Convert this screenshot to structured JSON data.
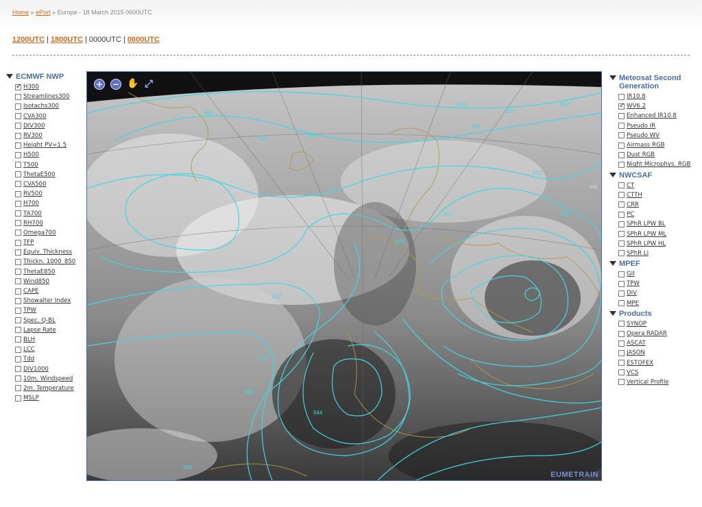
{
  "breadcrumb": {
    "home": "Home",
    "sep1": "»",
    "eport": "ePort",
    "rest": "» Europe - 18 March 2015 0600UTC"
  },
  "times": [
    {
      "label": "1200UTC",
      "link": true
    },
    {
      "label": "1800UTC",
      "link": true
    },
    {
      "label": "0000UTC",
      "link": false
    },
    {
      "label": "0600UTC",
      "link": true
    }
  ],
  "left_panel": {
    "title": "ECMWF NWP",
    "items": [
      {
        "label": "H300",
        "checked": true
      },
      {
        "label": "Streamlines300",
        "checked": false
      },
      {
        "label": "Isotachs300",
        "checked": false
      },
      {
        "label": "CVA300",
        "checked": false
      },
      {
        "label": "DIV300",
        "checked": false
      },
      {
        "label": "RV300",
        "checked": false
      },
      {
        "label": "Height PV=1.5",
        "checked": false
      },
      {
        "label": "H500",
        "checked": false
      },
      {
        "label": "T500",
        "checked": false
      },
      {
        "label": "ThetaE500",
        "checked": false
      },
      {
        "label": "CVA500",
        "checked": false
      },
      {
        "label": "RV500",
        "checked": false
      },
      {
        "label": "H700",
        "checked": false
      },
      {
        "label": "TA700",
        "checked": false
      },
      {
        "label": "RH700",
        "checked": false
      },
      {
        "label": "Omega700",
        "checked": false
      },
      {
        "label": "TFP",
        "checked": false
      },
      {
        "label": "Equiv. Thickness",
        "checked": false
      },
      {
        "label": "Thickn. 1000_850",
        "checked": false
      },
      {
        "label": "ThetaE850",
        "checked": false
      },
      {
        "label": "Wind850",
        "checked": false
      },
      {
        "label": "CAPE",
        "checked": false
      },
      {
        "label": "Showalter Index",
        "checked": false
      },
      {
        "label": "TPW",
        "checked": false
      },
      {
        "label": "Spec. Q-BL",
        "checked": false
      },
      {
        "label": "Lapse Rate",
        "checked": false
      },
      {
        "label": "BLH",
        "checked": false
      },
      {
        "label": "LCC",
        "checked": false
      },
      {
        "label": "Tdd",
        "checked": false
      },
      {
        "label": "DIV1000",
        "checked": false
      },
      {
        "label": "10m. Windspeed",
        "checked": false
      },
      {
        "label": "2m. Temperature",
        "checked": false
      },
      {
        "label": "MSLP",
        "checked": false
      }
    ]
  },
  "right_panel": {
    "groups": [
      {
        "title": "Meteosat Second Generation",
        "items": [
          {
            "label": "IR10.8",
            "checked": false
          },
          {
            "label": "WV6.2",
            "checked": true
          },
          {
            "label": "Enhanced IR10.8",
            "checked": false
          },
          {
            "label": "Pseudo IR",
            "checked": false
          },
          {
            "label": "Pseudo WV",
            "checked": false
          },
          {
            "label": "Airmass RGB",
            "checked": false
          },
          {
            "label": "Dust RGB",
            "checked": false
          },
          {
            "label": "Night Microphys. RGB",
            "checked": false
          }
        ]
      },
      {
        "title": "NWCSAF",
        "items": [
          {
            "label": "CT",
            "checked": false
          },
          {
            "label": "CTTH",
            "checked": false
          },
          {
            "label": "CRR",
            "checked": false
          },
          {
            "label": "PC",
            "checked": false
          },
          {
            "label": "SPhR LPW BL",
            "checked": false
          },
          {
            "label": "SPhR LPW ML",
            "checked": false
          },
          {
            "label": "SPhR LPW HL",
            "checked": false
          },
          {
            "label": "SPhR LI",
            "checked": false
          }
        ]
      },
      {
        "title": "MPEF",
        "items": [
          {
            "label": "GII",
            "checked": false
          },
          {
            "label": "TPW",
            "checked": false
          },
          {
            "label": "DIV",
            "checked": false
          },
          {
            "label": "MPE",
            "checked": false
          }
        ]
      },
      {
        "title": "Products",
        "items": [
          {
            "label": "SYNOP",
            "checked": false
          },
          {
            "label": "Opera RADAR",
            "checked": false
          },
          {
            "label": "ASCAT",
            "checked": false
          },
          {
            "label": "JASON",
            "checked": false
          },
          {
            "label": "ESTOFEX",
            "checked": false
          },
          {
            "label": "VCS",
            "checked": false
          },
          {
            "label": "Vertical Profile",
            "checked": false
          }
        ]
      }
    ]
  },
  "map": {
    "tools": [
      "zoom-in-icon",
      "zoom-out-icon",
      "pan-hand-icon",
      "fullscreen-icon"
    ],
    "contour_labels": [
      "864",
      "880",
      "896",
      "912",
      "928",
      "944",
      "912",
      "928",
      "912",
      "928",
      "944",
      "880",
      "896",
      "912",
      "928",
      "864"
    ],
    "lat_label": "50N",
    "watermark": "EUMETRAIN",
    "contour_color": "#3fd8e0",
    "coast_color": "#b39a4a"
  }
}
